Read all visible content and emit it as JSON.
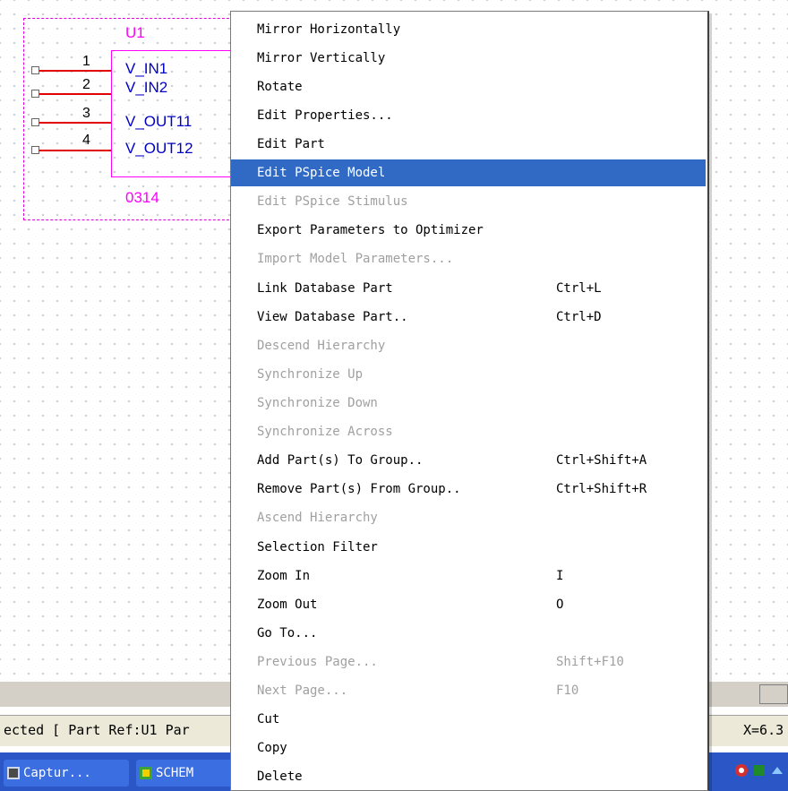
{
  "part": {
    "ref": "U1",
    "value": "0314",
    "pins": [
      {
        "num": "1",
        "name": "V_IN1"
      },
      {
        "num": "2",
        "name": "V_IN2"
      },
      {
        "num": "3",
        "name": "V_OUT11"
      },
      {
        "num": "4",
        "name": "V_OUT12"
      }
    ]
  },
  "menu": {
    "items": [
      {
        "label": "Mirror Horizontally",
        "shortcut": "",
        "enabled": true
      },
      {
        "label": "Mirror Vertically",
        "shortcut": "",
        "enabled": true
      },
      {
        "label": "Rotate",
        "shortcut": "",
        "enabled": true
      },
      {
        "label": "Edit Properties...",
        "shortcut": "",
        "enabled": true
      },
      {
        "label": "Edit Part",
        "shortcut": "",
        "enabled": true
      },
      {
        "label": "Edit PSpice Model",
        "shortcut": "",
        "enabled": true,
        "highlighted": true
      },
      {
        "label": "Edit PSpice Stimulus",
        "shortcut": "",
        "enabled": false
      },
      {
        "label": "Export Parameters to Optimizer",
        "shortcut": "",
        "enabled": true
      },
      {
        "label": "Import Model Parameters...",
        "shortcut": "",
        "enabled": false
      },
      {
        "label": "Link Database Part",
        "shortcut": "Ctrl+L",
        "enabled": true
      },
      {
        "label": "View Database Part..",
        "shortcut": "Ctrl+D",
        "enabled": true
      },
      {
        "label": "Descend Hierarchy",
        "shortcut": "",
        "enabled": false
      },
      {
        "label": "Synchronize Up",
        "shortcut": "",
        "enabled": false
      },
      {
        "label": "Synchronize Down",
        "shortcut": "",
        "enabled": false
      },
      {
        "label": "Synchronize Across",
        "shortcut": "",
        "enabled": false
      },
      {
        "label": "Add Part(s) To Group..",
        "shortcut": "Ctrl+Shift+A",
        "enabled": true
      },
      {
        "label": "Remove Part(s) From Group..",
        "shortcut": "Ctrl+Shift+R",
        "enabled": true
      },
      {
        "label": "Ascend Hierarchy",
        "shortcut": "",
        "enabled": false
      },
      {
        "label": "Selection Filter",
        "shortcut": "",
        "enabled": true
      },
      {
        "label": "Zoom In",
        "shortcut": "I",
        "enabled": true
      },
      {
        "label": "Zoom Out",
        "shortcut": "O",
        "enabled": true
      },
      {
        "label": "Go To...",
        "shortcut": "",
        "enabled": true
      },
      {
        "label": "Previous Page...",
        "shortcut": "Shift+F10",
        "enabled": false
      },
      {
        "label": "Next Page...",
        "shortcut": "F10",
        "enabled": false
      },
      {
        "label": "Cut",
        "shortcut": "",
        "enabled": true
      },
      {
        "label": "Copy",
        "shortcut": "",
        "enabled": true
      },
      {
        "label": "Delete",
        "shortcut": "",
        "enabled": true
      }
    ]
  },
  "status": {
    "text": "ected [ Part Ref:U1 Par",
    "coord": "X=6.3"
  },
  "taskbar": {
    "items": [
      {
        "label": "Captur...",
        "icon": "capture-app-icon"
      },
      {
        "label": "SCHEM",
        "icon": "schematic-app-icon"
      }
    ]
  },
  "colors": {
    "highlight": "#316ac5",
    "part_outline": "#ff00ff",
    "pin_wire": "#e00000",
    "pin_name": "#0000c8",
    "disabled_text": "#a0a0a0"
  }
}
